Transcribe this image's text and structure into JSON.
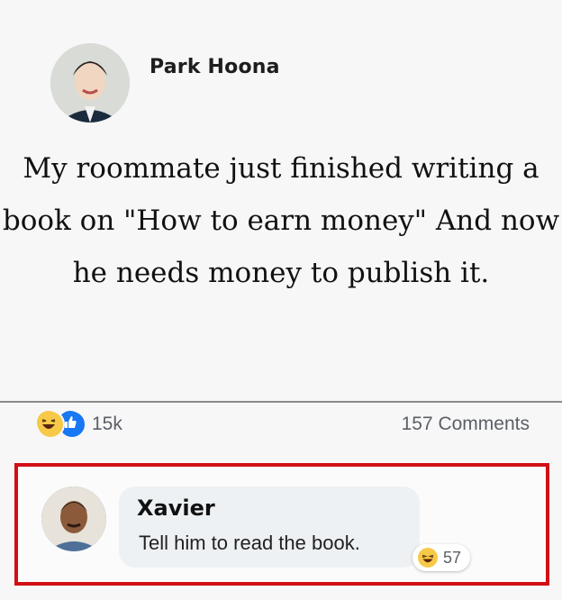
{
  "post": {
    "author": "Park Hoona",
    "text": "My roommate just finished writing a book on \"How to earn money\" And now he needs money to publish it.",
    "reactions": {
      "icons": [
        "haha-icon",
        "like-icon"
      ],
      "count": "15k"
    },
    "comments_count": "157 Comments"
  },
  "comment": {
    "author": "Xavier",
    "text": "Tell him to read the book.",
    "reaction": {
      "icon": "haha-icon",
      "count": "57"
    }
  },
  "colors": {
    "highlight_border": "#d10f14",
    "like_blue": "#1877f2",
    "haha_yellow": "#f7c948",
    "bubble_bg": "#eef1f3"
  }
}
